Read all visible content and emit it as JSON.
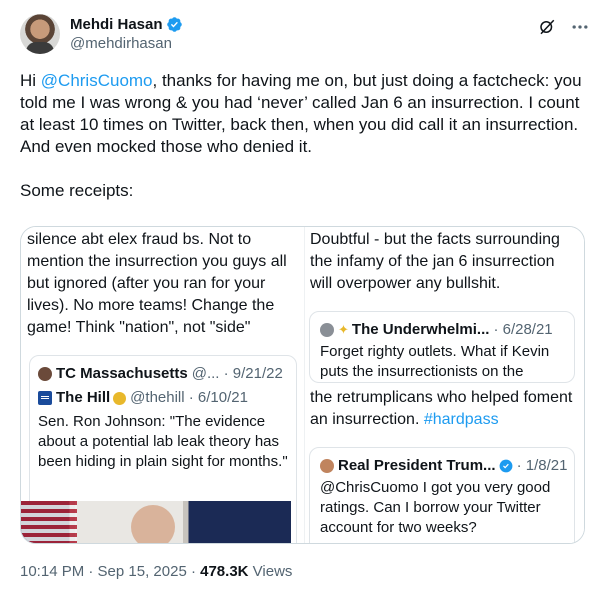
{
  "author": {
    "name": "Mehdi Hasan",
    "handle": "@mehdirhasan"
  },
  "tweet": {
    "greeting": "Hi ",
    "mention": "@ChrisCuomo",
    "body": ", thanks for having me on, but just doing a factcheck: you told me I was wrong & you had ‘never’ called Jan 6 an insurrection. I count at least 10 times on Twitter, back then, when you did call it an insurrection. And even mocked those who denied it.",
    "receipts": "Some receipts:"
  },
  "screenshots": {
    "left": {
      "text": "silence abt elex fraud bs. Not to mention the insurrection you guys all but ignored (after you ran for your lives). No more teams! Change the game! Think \"nation\", not \"side\"",
      "quote_outer": {
        "name": "TC Massachusetts",
        "meta": "@... · 9/21/22"
      },
      "quote_inner": {
        "name": "The Hill",
        "meta": "@thehill · 6/10/21",
        "text": "Sen. Ron Johnson: \"The evidence about a potential lab leak theory has been hiding in plain sight for months.\""
      }
    },
    "right": {
      "top_text": "Doubtful - but the facts surrounding the infamy of the jan 6 insurrection will overpower any bullshit.",
      "quote1": {
        "name": "The Underwhelmi...",
        "meta": "· 6/28/21",
        "text": "Forget righty outlets. What if Kevin puts the insurrectionists on the"
      },
      "mid_text": "the retrumplicans who helped foment an insurrection. ",
      "mid_hashtag": "#hardpass",
      "quote2": {
        "name": "Real President Trum...",
        "meta": "· 1/8/21",
        "text": "@ChrisCuomo I got you very good ratings. Can I borrow your Twitter account for two weeks?"
      }
    }
  },
  "footer": {
    "time": "10:14 PM · Sep 15, 2025 · ",
    "views_count": "478.3K",
    "views_label": " Views"
  },
  "colors": {
    "link": "#1d9bf0",
    "verified": "#1d9bf0",
    "secondary_text": "#536471"
  },
  "icons": [
    "verified-badge-icon",
    "grok-icon",
    "more-icon"
  ]
}
